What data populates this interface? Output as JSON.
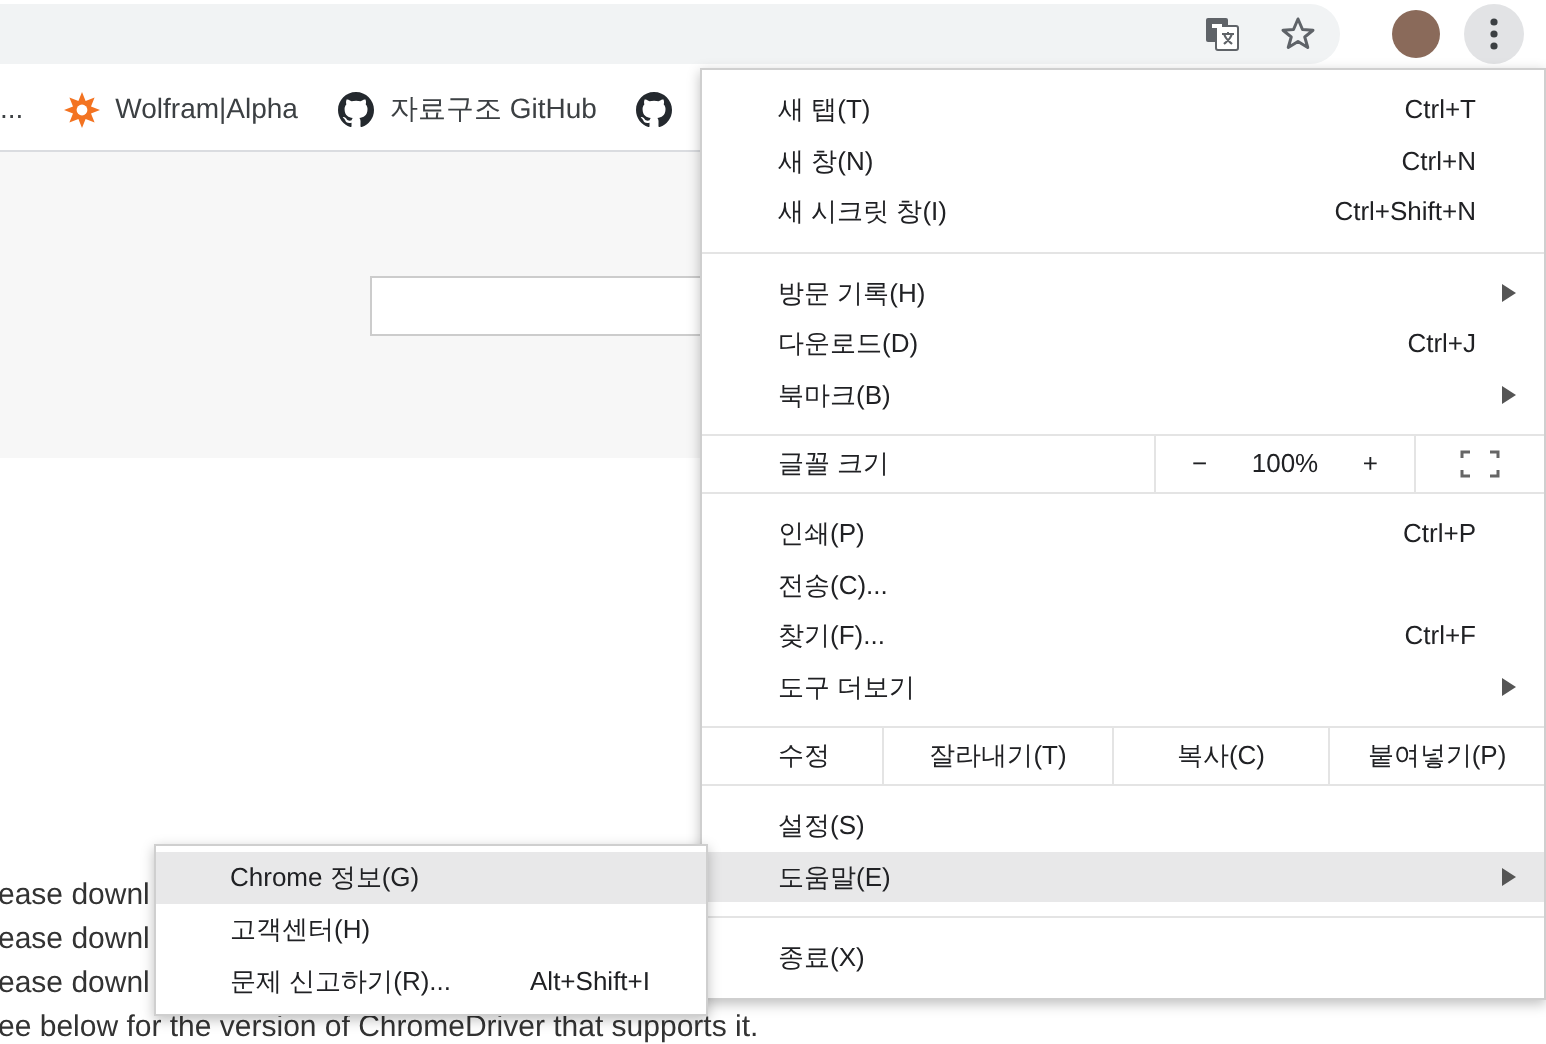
{
  "bookmarks": [
    {
      "kind": "text",
      "label": "..."
    },
    {
      "kind": "wolfram",
      "label": "Wolfram|Alpha"
    },
    {
      "kind": "github",
      "label": "자료구조 GitHub"
    },
    {
      "kind": "github"
    }
  ],
  "page_lines": [
    "ease downl",
    "ease downl",
    "ease downl",
    "ee below for the version of ChromeDriver that supports it."
  ],
  "menu": [
    {
      "kind": "items",
      "items": [
        {
          "label": "새 탭(T)",
          "shortcut": "Ctrl+T",
          "submenu": false,
          "selected": false
        },
        {
          "label": "새 창(N)",
          "shortcut": "Ctrl+N",
          "submenu": false,
          "selected": false
        },
        {
          "label": "새 시크릿 창(I)",
          "shortcut": "Ctrl+Shift+N",
          "submenu": false,
          "selected": false
        }
      ]
    },
    {
      "kind": "items",
      "items": [
        {
          "label": "방문 기록(H)",
          "submenu": true,
          "selected": false
        },
        {
          "label": "다운로드(D)",
          "shortcut": "Ctrl+J",
          "submenu": false,
          "selected": false
        },
        {
          "label": "북마크(B)",
          "submenu": true,
          "selected": false
        }
      ]
    },
    {
      "kind": "zoom",
      "label": "글꼴 크기",
      "minus": "−",
      "value": "100%",
      "plus": "+"
    },
    {
      "kind": "items",
      "items": [
        {
          "label": "인쇄(P)",
          "shortcut": "Ctrl+P",
          "submenu": false,
          "selected": false
        },
        {
          "label": "전송(C)...",
          "submenu": false,
          "selected": false
        },
        {
          "label": "찾기(F)...",
          "shortcut": "Ctrl+F",
          "submenu": false,
          "selected": false
        },
        {
          "label": "도구 더보기",
          "submenu": true,
          "selected": false
        }
      ]
    },
    {
      "kind": "edit",
      "label": "수정",
      "buttons": [
        "잘라내기(T)",
        "복사(C)",
        "붙여넣기(P)"
      ]
    },
    {
      "kind": "items",
      "items": [
        {
          "label": "설정(S)",
          "submenu": false,
          "selected": false
        },
        {
          "label": "도움말(E)",
          "submenu": true,
          "selected": true
        }
      ]
    },
    {
      "kind": "items",
      "items": [
        {
          "label": "종료(X)",
          "submenu": false,
          "selected": false
        }
      ]
    }
  ],
  "submenu": [
    {
      "label": "Chrome 정보(G)",
      "selected": true
    },
    {
      "label": "고객센터(H)",
      "selected": false
    },
    {
      "label": "문제 신고하기(R)...",
      "shortcut": "Alt+Shift+I",
      "selected": false
    }
  ]
}
